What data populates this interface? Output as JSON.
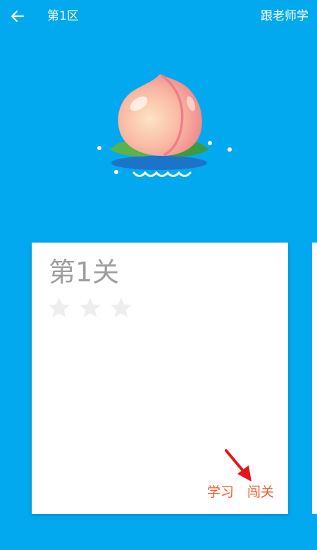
{
  "header": {
    "back_icon": "arrow-left-icon",
    "title": "第1区",
    "follow_label": "跟老师学"
  },
  "hero": {
    "icon": "peach-icon"
  },
  "level_card": {
    "title": "第1关",
    "stars_earned": 0,
    "stars_total": 3,
    "study_label": "学习",
    "challenge_label": "闯关"
  },
  "colors": {
    "background": "#03A9EF",
    "card": "#FFFFFF",
    "action_text": "#F05A2A",
    "star_empty": "#EEEEEE",
    "arrow": "#E8141B"
  }
}
